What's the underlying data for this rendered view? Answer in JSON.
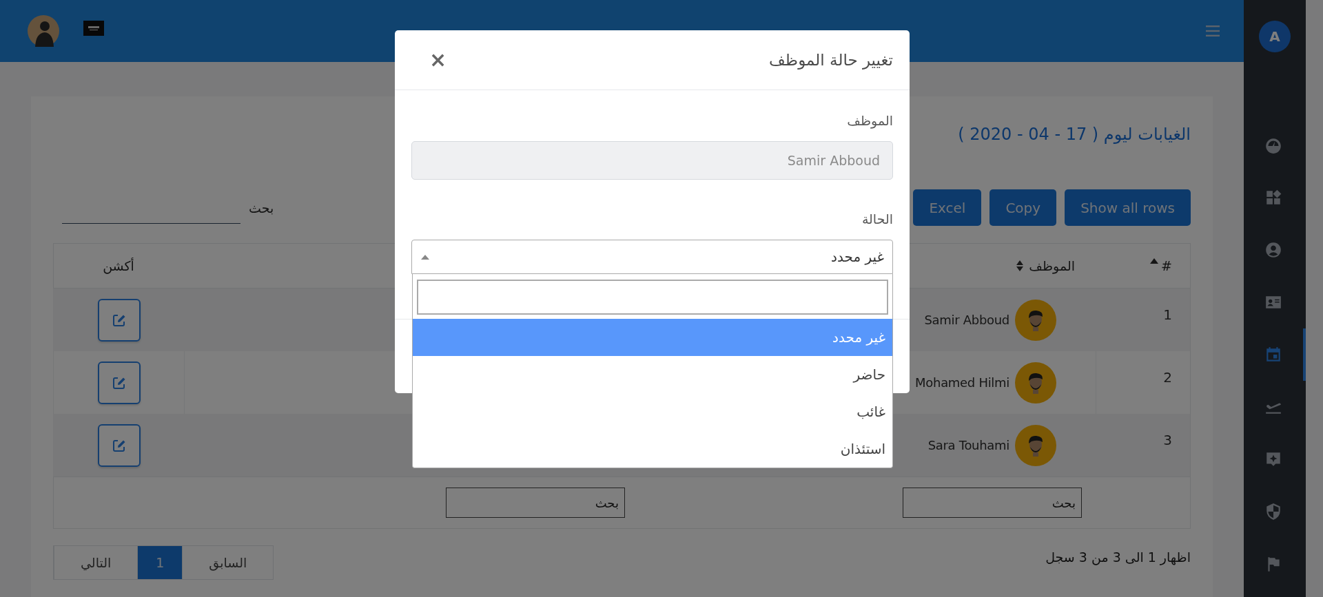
{
  "sidebar": {
    "logo_text": "A",
    "items": [
      {
        "selected": false
      },
      {
        "selected": false
      },
      {
        "selected": false
      },
      {
        "selected": false
      },
      {
        "selected": true
      },
      {
        "selected": false
      },
      {
        "selected": false
      },
      {
        "selected": false
      },
      {
        "selected": false
      }
    ]
  },
  "page": {
    "title": "الغيابات ليوم ( 17 - 04 - 2020 )",
    "buttons": [
      "Show all rows",
      "Copy",
      "Excel"
    ],
    "search_label": "بحث",
    "table": {
      "columns": [
        {
          "label": "#",
          "sorted_ascending": true
        },
        {
          "label": "الموظف",
          "sortable": true
        },
        {
          "label": "أكشن"
        }
      ],
      "rows": [
        {
          "number": "1",
          "name": "Samir Abboud"
        },
        {
          "number": "2",
          "name": "Mohamed Hilmi"
        },
        {
          "number": "3",
          "name": "Sara Touhami"
        }
      ],
      "filters": [
        {
          "value": "بحث"
        },
        {
          "value": "بحث"
        }
      ]
    },
    "info": "اظهار 1 الى 3 من 3 سجل",
    "pagination": [
      {
        "label": "السابق",
        "selected": false
      },
      {
        "label": "1",
        "selected": true
      },
      {
        "label": "التالي",
        "selected": false
      }
    ]
  },
  "modal": {
    "title": "تغيير حالة الموظف",
    "close": "×",
    "employee_label": "الموظف",
    "employee_value": "Samir Abboud",
    "employee_disabled": true,
    "status_label": "الحالة",
    "status_value": "غير محدد",
    "options": [
      {
        "label": "غير محدد",
        "selected": true
      },
      {
        "label": "حاضر",
        "selected": false
      },
      {
        "label": "غائب",
        "selected": false
      },
      {
        "label": "استئذان",
        "selected": false
      }
    ]
  }
}
